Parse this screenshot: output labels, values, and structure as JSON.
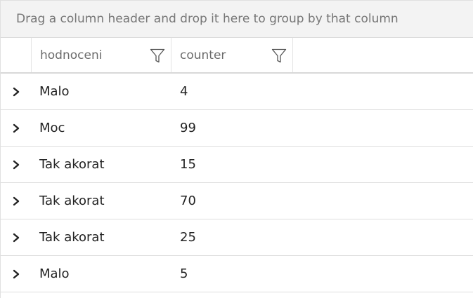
{
  "group_panel": {
    "hint": "Drag a column header and drop it here to group by that column"
  },
  "columns": [
    {
      "label": "hodnoceni",
      "filter_icon": "filter-icon"
    },
    {
      "label": "counter",
      "filter_icon": "filter-icon"
    }
  ],
  "rows": [
    {
      "hodnoceni": "Malo",
      "counter": "4"
    },
    {
      "hodnoceni": "Moc",
      "counter": "99"
    },
    {
      "hodnoceni": "Tak akorat",
      "counter": "15"
    },
    {
      "hodnoceni": "Tak akorat",
      "counter": "70"
    },
    {
      "hodnoceni": "Tak akorat",
      "counter": "25"
    },
    {
      "hodnoceni": "Malo",
      "counter": "5"
    }
  ],
  "colors": {
    "group_panel_bg": "#f3f3f3",
    "text": "#222222",
    "header_text": "#6b6b6b"
  }
}
